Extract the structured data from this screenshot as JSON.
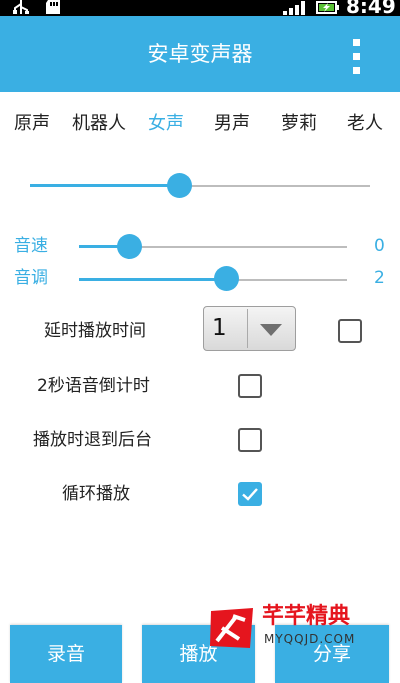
{
  "status_bar": {
    "time": "8:49",
    "icons": [
      "usb-icon",
      "sd-card-icon",
      "signal-icon",
      "battery-charging-icon"
    ]
  },
  "app": {
    "title": "安卓变声器",
    "menu_icon": "overflow-menu-icon"
  },
  "voice_tabs": [
    {
      "label": "原声",
      "selected": false
    },
    {
      "label": "机器人",
      "selected": false
    },
    {
      "label": "女声",
      "selected": true
    },
    {
      "label": "男声",
      "selected": false
    },
    {
      "label": "萝莉",
      "selected": false
    },
    {
      "label": "老人",
      "selected": false
    }
  ],
  "main_slider": {
    "level": 0.44
  },
  "speed": {
    "label": "音速",
    "value": "0",
    "level": 0.19
  },
  "pitch": {
    "label": "音调",
    "value": "2",
    "level": 0.55
  },
  "options": {
    "delay": {
      "label": "延时播放时间",
      "selected_value": "1",
      "checked": false
    },
    "countdown": {
      "label": "2秒语音倒计时",
      "checked": false
    },
    "background": {
      "label": "播放时退到后台",
      "checked": false
    },
    "loop": {
      "label": "循环播放",
      "checked": true
    }
  },
  "buttons": {
    "record": "录音",
    "play": "播放",
    "share": "分享"
  },
  "watermark": {
    "title": "芊芊精典",
    "url": "MYQQJD.COM"
  },
  "colors": {
    "accent": "#3aafe3",
    "watermark_red": "#e5151e"
  }
}
